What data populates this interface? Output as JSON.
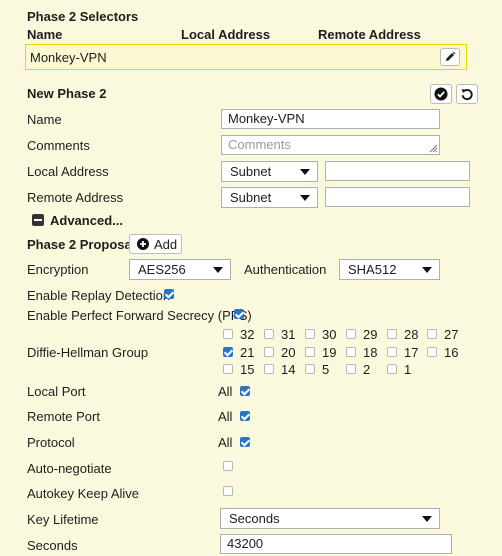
{
  "selectors": {
    "title": "Phase 2 Selectors",
    "col_name": "Name",
    "col_local": "Local Address",
    "col_remote": "Remote Address",
    "row_name": "Monkey-VPN"
  },
  "new_phase": {
    "title": "New Phase 2",
    "name_label": "Name",
    "name_value": "Monkey-VPN",
    "comments_label": "Comments",
    "comments_placeholder": "Comments",
    "local_label": "Local Address",
    "local_type": "Subnet",
    "remote_label": "Remote Address",
    "remote_type": "Subnet",
    "advanced_label": "Advanced..."
  },
  "proposal": {
    "label": "Phase 2 Proposal",
    "add_label": "Add",
    "encryption_label": "Encryption",
    "encryption_value": "AES256",
    "auth_label": "Authentication",
    "auth_value": "SHA512",
    "replay_label": "Enable Replay Detection",
    "replay_checked": true,
    "pfs_label": "Enable Perfect Forward Secrecy (PFS)",
    "pfs_checked": true
  },
  "dh": {
    "label": "Diffie-Hellman Group",
    "groups": [
      {
        "n": "32",
        "on": false
      },
      {
        "n": "31",
        "on": false
      },
      {
        "n": "30",
        "on": false
      },
      {
        "n": "29",
        "on": false
      },
      {
        "n": "28",
        "on": false
      },
      {
        "n": "27",
        "on": false
      },
      {
        "n": "21",
        "on": true
      },
      {
        "n": "20",
        "on": false
      },
      {
        "n": "19",
        "on": false
      },
      {
        "n": "18",
        "on": false
      },
      {
        "n": "17",
        "on": false
      },
      {
        "n": "16",
        "on": false
      },
      {
        "n": "15",
        "on": false
      },
      {
        "n": "14",
        "on": false
      },
      {
        "n": "5",
        "on": false
      },
      {
        "n": "2",
        "on": false
      },
      {
        "n": "1",
        "on": false
      }
    ]
  },
  "ports": {
    "local_label": "Local Port",
    "local_value": "All",
    "remote_label": "Remote Port",
    "remote_value": "All",
    "protocol_label": "Protocol",
    "protocol_value": "All"
  },
  "auto": {
    "negotiate_label": "Auto-negotiate",
    "keepalive_label": "Autokey Keep Alive"
  },
  "lifetime": {
    "label": "Key Lifetime",
    "value": "Seconds",
    "seconds_label": "Seconds",
    "seconds_value": "43200"
  }
}
